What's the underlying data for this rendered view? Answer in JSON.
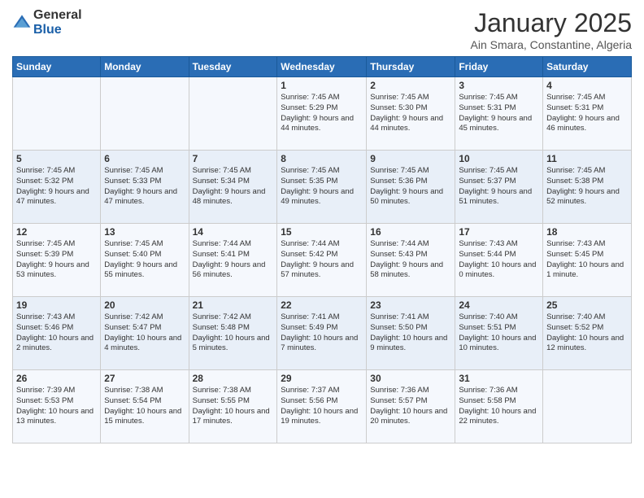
{
  "header": {
    "logo_general": "General",
    "logo_blue": "Blue",
    "title": "January 2025",
    "subtitle": "Ain Smara, Constantine, Algeria"
  },
  "days_of_week": [
    "Sunday",
    "Monday",
    "Tuesday",
    "Wednesday",
    "Thursday",
    "Friday",
    "Saturday"
  ],
  "weeks": [
    [
      {
        "day": "",
        "sunrise": "",
        "sunset": "",
        "daylight": ""
      },
      {
        "day": "",
        "sunrise": "",
        "sunset": "",
        "daylight": ""
      },
      {
        "day": "",
        "sunrise": "",
        "sunset": "",
        "daylight": ""
      },
      {
        "day": "1",
        "sunrise": "Sunrise: 7:45 AM",
        "sunset": "Sunset: 5:29 PM",
        "daylight": "Daylight: 9 hours and 44 minutes."
      },
      {
        "day": "2",
        "sunrise": "Sunrise: 7:45 AM",
        "sunset": "Sunset: 5:30 PM",
        "daylight": "Daylight: 9 hours and 44 minutes."
      },
      {
        "day": "3",
        "sunrise": "Sunrise: 7:45 AM",
        "sunset": "Sunset: 5:31 PM",
        "daylight": "Daylight: 9 hours and 45 minutes."
      },
      {
        "day": "4",
        "sunrise": "Sunrise: 7:45 AM",
        "sunset": "Sunset: 5:31 PM",
        "daylight": "Daylight: 9 hours and 46 minutes."
      }
    ],
    [
      {
        "day": "5",
        "sunrise": "Sunrise: 7:45 AM",
        "sunset": "Sunset: 5:32 PM",
        "daylight": "Daylight: 9 hours and 47 minutes."
      },
      {
        "day": "6",
        "sunrise": "Sunrise: 7:45 AM",
        "sunset": "Sunset: 5:33 PM",
        "daylight": "Daylight: 9 hours and 47 minutes."
      },
      {
        "day": "7",
        "sunrise": "Sunrise: 7:45 AM",
        "sunset": "Sunset: 5:34 PM",
        "daylight": "Daylight: 9 hours and 48 minutes."
      },
      {
        "day": "8",
        "sunrise": "Sunrise: 7:45 AM",
        "sunset": "Sunset: 5:35 PM",
        "daylight": "Daylight: 9 hours and 49 minutes."
      },
      {
        "day": "9",
        "sunrise": "Sunrise: 7:45 AM",
        "sunset": "Sunset: 5:36 PM",
        "daylight": "Daylight: 9 hours and 50 minutes."
      },
      {
        "day": "10",
        "sunrise": "Sunrise: 7:45 AM",
        "sunset": "Sunset: 5:37 PM",
        "daylight": "Daylight: 9 hours and 51 minutes."
      },
      {
        "day": "11",
        "sunrise": "Sunrise: 7:45 AM",
        "sunset": "Sunset: 5:38 PM",
        "daylight": "Daylight: 9 hours and 52 minutes."
      }
    ],
    [
      {
        "day": "12",
        "sunrise": "Sunrise: 7:45 AM",
        "sunset": "Sunset: 5:39 PM",
        "daylight": "Daylight: 9 hours and 53 minutes."
      },
      {
        "day": "13",
        "sunrise": "Sunrise: 7:45 AM",
        "sunset": "Sunset: 5:40 PM",
        "daylight": "Daylight: 9 hours and 55 minutes."
      },
      {
        "day": "14",
        "sunrise": "Sunrise: 7:44 AM",
        "sunset": "Sunset: 5:41 PM",
        "daylight": "Daylight: 9 hours and 56 minutes."
      },
      {
        "day": "15",
        "sunrise": "Sunrise: 7:44 AM",
        "sunset": "Sunset: 5:42 PM",
        "daylight": "Daylight: 9 hours and 57 minutes."
      },
      {
        "day": "16",
        "sunrise": "Sunrise: 7:44 AM",
        "sunset": "Sunset: 5:43 PM",
        "daylight": "Daylight: 9 hours and 58 minutes."
      },
      {
        "day": "17",
        "sunrise": "Sunrise: 7:43 AM",
        "sunset": "Sunset: 5:44 PM",
        "daylight": "Daylight: 10 hours and 0 minutes."
      },
      {
        "day": "18",
        "sunrise": "Sunrise: 7:43 AM",
        "sunset": "Sunset: 5:45 PM",
        "daylight": "Daylight: 10 hours and 1 minute."
      }
    ],
    [
      {
        "day": "19",
        "sunrise": "Sunrise: 7:43 AM",
        "sunset": "Sunset: 5:46 PM",
        "daylight": "Daylight: 10 hours and 2 minutes."
      },
      {
        "day": "20",
        "sunrise": "Sunrise: 7:42 AM",
        "sunset": "Sunset: 5:47 PM",
        "daylight": "Daylight: 10 hours and 4 minutes."
      },
      {
        "day": "21",
        "sunrise": "Sunrise: 7:42 AM",
        "sunset": "Sunset: 5:48 PM",
        "daylight": "Daylight: 10 hours and 5 minutes."
      },
      {
        "day": "22",
        "sunrise": "Sunrise: 7:41 AM",
        "sunset": "Sunset: 5:49 PM",
        "daylight": "Daylight: 10 hours and 7 minutes."
      },
      {
        "day": "23",
        "sunrise": "Sunrise: 7:41 AM",
        "sunset": "Sunset: 5:50 PM",
        "daylight": "Daylight: 10 hours and 9 minutes."
      },
      {
        "day": "24",
        "sunrise": "Sunrise: 7:40 AM",
        "sunset": "Sunset: 5:51 PM",
        "daylight": "Daylight: 10 hours and 10 minutes."
      },
      {
        "day": "25",
        "sunrise": "Sunrise: 7:40 AM",
        "sunset": "Sunset: 5:52 PM",
        "daylight": "Daylight: 10 hours and 12 minutes."
      }
    ],
    [
      {
        "day": "26",
        "sunrise": "Sunrise: 7:39 AM",
        "sunset": "Sunset: 5:53 PM",
        "daylight": "Daylight: 10 hours and 13 minutes."
      },
      {
        "day": "27",
        "sunrise": "Sunrise: 7:38 AM",
        "sunset": "Sunset: 5:54 PM",
        "daylight": "Daylight: 10 hours and 15 minutes."
      },
      {
        "day": "28",
        "sunrise": "Sunrise: 7:38 AM",
        "sunset": "Sunset: 5:55 PM",
        "daylight": "Daylight: 10 hours and 17 minutes."
      },
      {
        "day": "29",
        "sunrise": "Sunrise: 7:37 AM",
        "sunset": "Sunset: 5:56 PM",
        "daylight": "Daylight: 10 hours and 19 minutes."
      },
      {
        "day": "30",
        "sunrise": "Sunrise: 7:36 AM",
        "sunset": "Sunset: 5:57 PM",
        "daylight": "Daylight: 10 hours and 20 minutes."
      },
      {
        "day": "31",
        "sunrise": "Sunrise: 7:36 AM",
        "sunset": "Sunset: 5:58 PM",
        "daylight": "Daylight: 10 hours and 22 minutes."
      },
      {
        "day": "",
        "sunrise": "",
        "sunset": "",
        "daylight": ""
      }
    ]
  ]
}
